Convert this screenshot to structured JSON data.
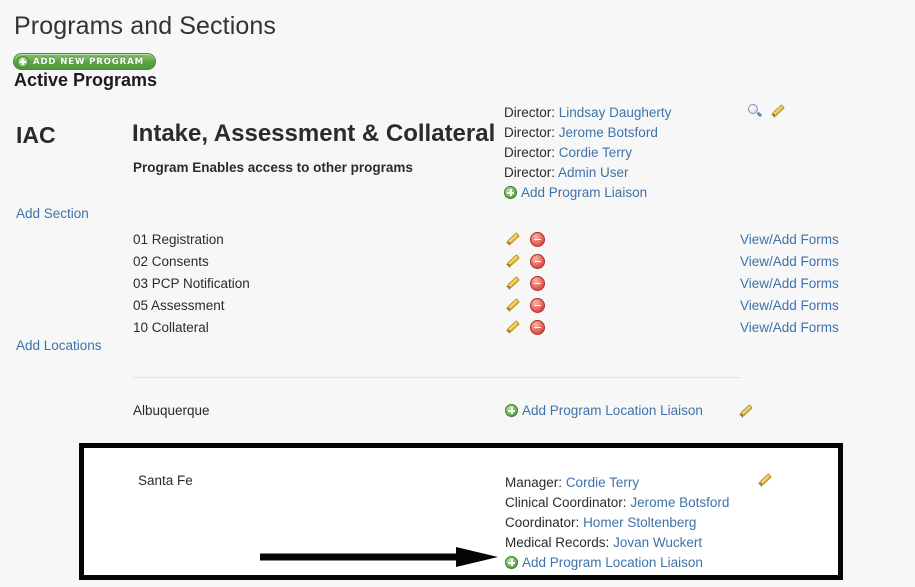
{
  "page": {
    "title": "Programs and Sections",
    "add_new_program_label": "ADD NEW PROGRAM",
    "active_programs_heading": "Active Programs",
    "background_color": "#f7f7f7",
    "link_color": "#3e72ab"
  },
  "program": {
    "code": "IAC",
    "name": "Intake, Assessment & Collateral",
    "subtitle": "Program Enables access to other programs",
    "liaisons": [
      {
        "role": "Director:",
        "person": "Lindsay Daugherty"
      },
      {
        "role": "Director:",
        "person": "Jerome Botsford"
      },
      {
        "role": "Director:",
        "person": "Cordie Terry"
      },
      {
        "role": "Director:",
        "person": "Admin User"
      }
    ],
    "add_liaison_label": "Add Program Liaison",
    "icons": [
      "search-icon",
      "edit-pencil-icon"
    ]
  },
  "links": {
    "add_section": "Add Section",
    "add_locations": "Add Locations",
    "view_add_forms": "View/Add Forms",
    "add_program_location_liaison": "Add Program Location Liaison"
  },
  "sections": [
    {
      "name": "01 Registration",
      "forms": "View/Add Forms"
    },
    {
      "name": "02 Consents",
      "forms": "View/Add Forms"
    },
    {
      "name": "03 PCP Notification",
      "forms": "View/Add Forms"
    },
    {
      "name": "05 Assessment",
      "forms": "View/Add Forms"
    },
    {
      "name": "10 Collateral",
      "forms": "View/Add Forms"
    }
  ],
  "locations": [
    {
      "name": "Albuquerque",
      "add_liaison_label": "Add Program Location Liaison",
      "liaisons": [],
      "highlighted": false
    },
    {
      "name": "Santa Fe",
      "add_liaison_label": "Add Program Location Liaison",
      "liaisons": [
        {
          "role": "Manager:",
          "person": "Cordie Terry"
        },
        {
          "role": "Clinical Coordinator:",
          "person": "Jerome Botsford"
        },
        {
          "role": "Coordinator:",
          "person": "Homer Stoltenberg"
        },
        {
          "role": "Medical Records:",
          "person": "Jovan Wuckert"
        }
      ],
      "highlighted": true
    }
  ],
  "annotation": {
    "type": "arrow",
    "color": "#050505",
    "points_to": "add-program-location-liaison-santa-fe"
  }
}
